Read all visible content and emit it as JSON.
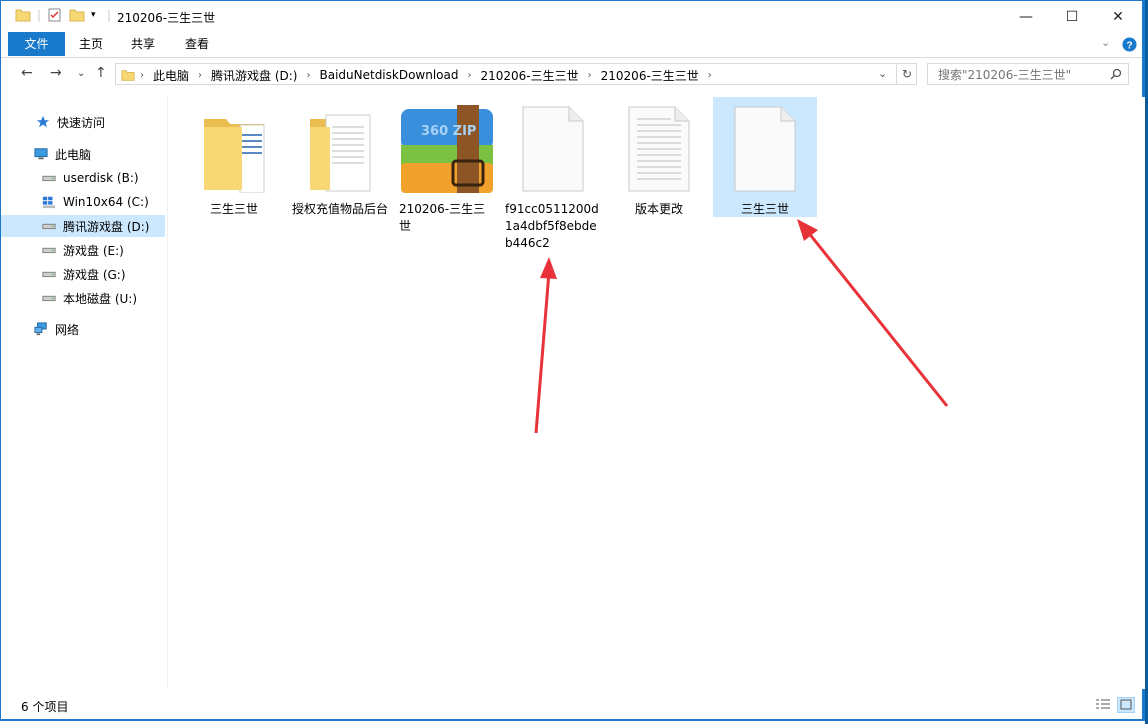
{
  "window": {
    "title": "210206-三生三世",
    "controls": {
      "minimize": "—",
      "maximize": "☐",
      "close": "✕"
    }
  },
  "ribbon": {
    "tabs": [
      "文件",
      "主页",
      "共享",
      "查看"
    ],
    "expand_icon": "chevron-down-icon",
    "help_icon": "help-icon"
  },
  "address": {
    "breadcrumbs": [
      "此电脑",
      "腾讯游戏盘 (D:)",
      "BaiduNetdiskDownload",
      "210206-三生三世",
      "210206-三生三世"
    ],
    "search_placeholder": "搜索\"210206-三生三世\""
  },
  "nav": {
    "quick_access": "快速访问",
    "this_pc": "此电脑",
    "drives": [
      {
        "label": "userdisk (B:)",
        "selected": false
      },
      {
        "label": "Win10x64 (C:)",
        "selected": false
      },
      {
        "label": "腾讯游戏盘 (D:)",
        "selected": true
      },
      {
        "label": "游戏盘 (E:)",
        "selected": false
      },
      {
        "label": "游戏盘 (G:)",
        "selected": false
      },
      {
        "label": "本地磁盘 (U:)",
        "selected": false
      }
    ],
    "network": "网络"
  },
  "files": [
    {
      "name": "三生三世",
      "type": "folder",
      "selected": false
    },
    {
      "name": "授权充值物品后台",
      "type": "folder-doc",
      "selected": false
    },
    {
      "name": "210206-三生三世",
      "type": "zip",
      "selected": false
    },
    {
      "name": "f91cc0511200d1a4dbf5f8ebdeb446c2",
      "type": "file-blank",
      "selected": false
    },
    {
      "name": "版本更改",
      "type": "file-text",
      "selected": false
    },
    {
      "name": "三生三世",
      "type": "file-blank",
      "selected": true
    }
  ],
  "zip_icon_text": "360 ZIP",
  "status": {
    "count": "6 个项目"
  },
  "colors": {
    "accent": "#1979ca",
    "selection": "#cce8ff",
    "folder": "#f8d775",
    "arrow": "#e8323a"
  }
}
